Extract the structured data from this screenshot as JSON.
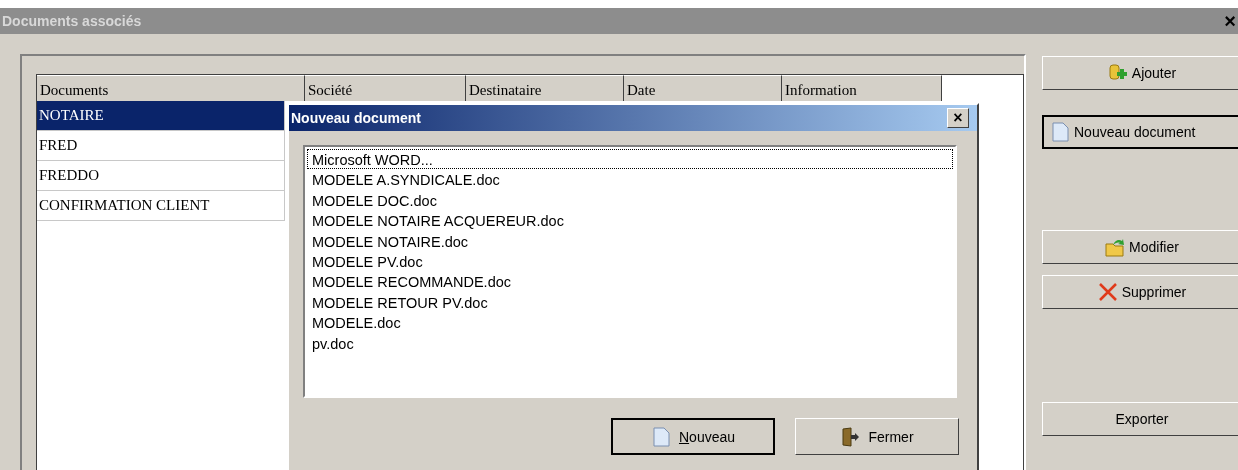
{
  "window": {
    "title": "Documents associés",
    "close": "×"
  },
  "table": {
    "columns": [
      "Documents",
      "Société",
      "Destinataire",
      "Date",
      "Information"
    ],
    "rows": [
      {
        "name": "NOTAIRE",
        "selected": true
      },
      {
        "name": "FRED",
        "selected": false
      },
      {
        "name": "FREDDO",
        "selected": false
      },
      {
        "name": "CONFIRMATION CLIENT",
        "selected": false
      }
    ]
  },
  "buttons": [
    {
      "label": "Ajouter",
      "kind": "add",
      "default": false
    },
    {
      "label": "Nouveau document",
      "kind": "new",
      "default": true
    },
    {
      "label": "Modifier",
      "kind": "edit",
      "default": false
    },
    {
      "label": "Supprimer",
      "kind": "delete",
      "default": false
    },
    {
      "label": "Exporter",
      "kind": "plain",
      "default": false
    }
  ],
  "dialog": {
    "title": "Nouveau document",
    "close": "×",
    "items": [
      {
        "label": "Microsoft WORD...",
        "focused": true
      },
      {
        "label": "MODELE A.SYNDICALE.doc",
        "focused": false
      },
      {
        "label": "MODELE DOC.doc",
        "focused": false
      },
      {
        "label": "MODELE NOTAIRE ACQUEREUR.doc",
        "focused": false
      },
      {
        "label": "MODELE NOTAIRE.doc",
        "focused": false
      },
      {
        "label": "MODELE PV.doc",
        "focused": false
      },
      {
        "label": "MODELE RECOMMANDE.doc",
        "focused": false
      },
      {
        "label": "MODELE RETOUR PV.doc",
        "focused": false
      },
      {
        "label": "MODELE.doc",
        "focused": false
      },
      {
        "label": "pv.doc",
        "focused": false
      }
    ],
    "buttons": [
      {
        "label": "Nouveau",
        "kind": "new",
        "default": true,
        "underline_first": true
      },
      {
        "label": "Fermer",
        "kind": "close",
        "default": false,
        "underline_first": false
      }
    ]
  }
}
